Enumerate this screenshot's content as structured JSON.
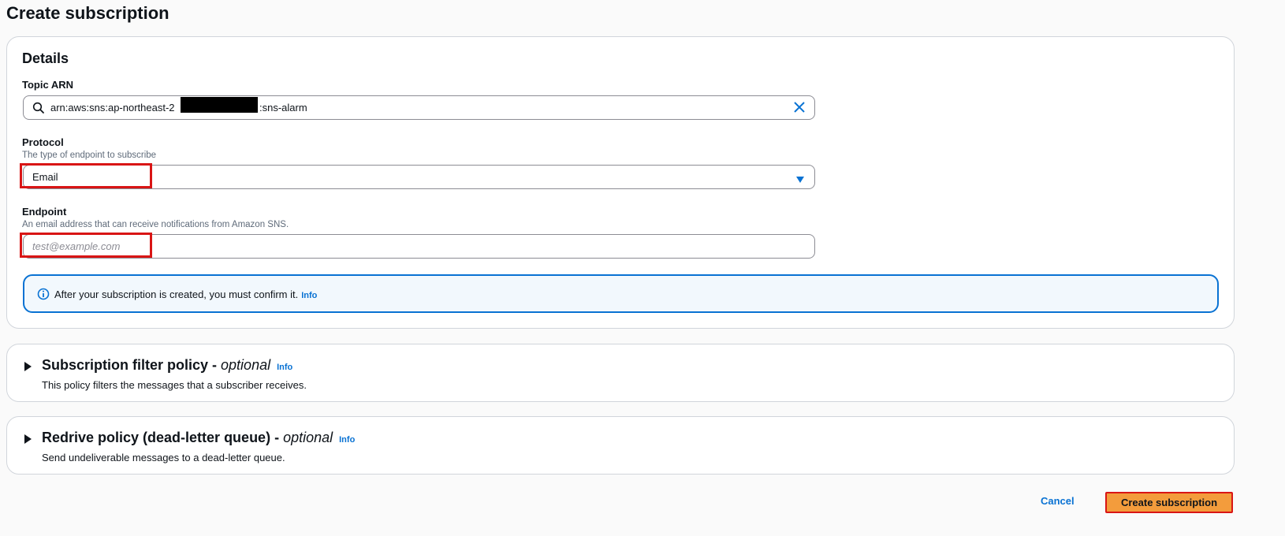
{
  "page": {
    "title": "Create subscription"
  },
  "details": {
    "heading": "Details",
    "topic_arn": {
      "label": "Topic ARN",
      "value_prefix": "arn:aws:sns:ap-northeast-2",
      "value_suffix": ":sns-alarm"
    },
    "protocol": {
      "label": "Protocol",
      "description": "The type of endpoint to subscribe",
      "selected": "Email"
    },
    "endpoint": {
      "label": "Endpoint",
      "description": "An email address that can receive notifications from Amazon SNS.",
      "placeholder": "test@example.com"
    },
    "alert": {
      "text": "After your subscription is created, you must confirm it.",
      "info": "Info"
    }
  },
  "filter_policy": {
    "title": "Subscription filter policy - ",
    "optional": "optional",
    "info": "Info",
    "description": "This policy filters the messages that a subscriber receives."
  },
  "redrive_policy": {
    "title": "Redrive policy (dead-letter queue) - ",
    "optional": "optional",
    "info": "Info",
    "description": "Send undeliverable messages to a dead-letter queue."
  },
  "actions": {
    "cancel": "Cancel",
    "create": "Create subscription"
  },
  "colors": {
    "accent": "#0972d3",
    "primary_button": "#f39c3c",
    "highlight": "#d91515"
  }
}
